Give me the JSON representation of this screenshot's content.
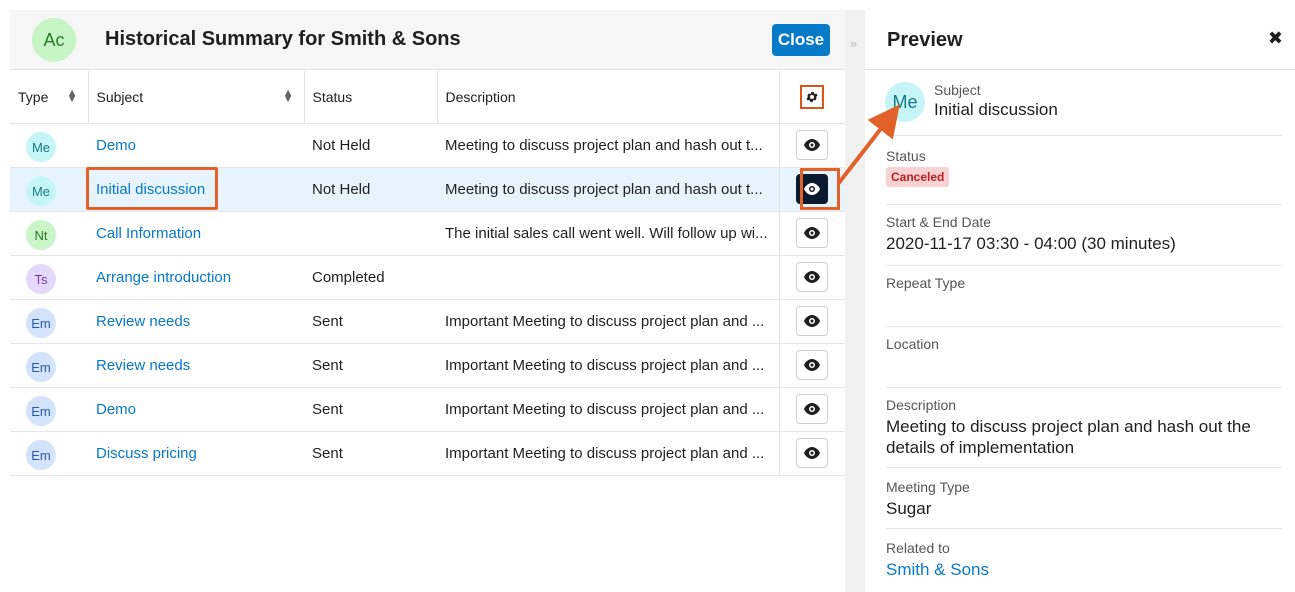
{
  "modal": {
    "avatar_initials": "Ac",
    "title": "Historical Summary for Smith & Sons",
    "close_label": "Close",
    "collapse_glyph": "»"
  },
  "table": {
    "columns": [
      "Type",
      "Subject",
      "Status",
      "Description"
    ],
    "rows": [
      {
        "type": "Me",
        "type_color": "#c6f5f7",
        "type_text_color": "#147a83",
        "subject": "Demo",
        "status": "Not Held",
        "description": "Meeting to discuss project plan and hash out t..."
      },
      {
        "type": "Me",
        "type_color": "#c6f5f7",
        "type_text_color": "#147a83",
        "subject": "Initial discussion",
        "status": "Not Held",
        "description": "Meeting to discuss project plan and hash out t..."
      },
      {
        "type": "Nt",
        "type_color": "#c9f5c9",
        "type_text_color": "#2a7a2a",
        "subject": "Call Information",
        "status": "",
        "description": "The initial sales call went well. Will follow up wi..."
      },
      {
        "type": "Ts",
        "type_color": "#e6d8fb",
        "type_text_color": "#6a3fb2",
        "subject": "Arrange introduction",
        "status": "Completed",
        "description": ""
      },
      {
        "type": "Em",
        "type_color": "#d3e3fb",
        "type_text_color": "#2b5aa8",
        "subject": "Review needs",
        "status": "Sent",
        "description": "Important Meeting to discuss project plan and ..."
      },
      {
        "type": "Em",
        "type_color": "#d3e3fb",
        "type_text_color": "#2b5aa8",
        "subject": "Review needs",
        "status": "Sent",
        "description": "Important Meeting to discuss project plan and ..."
      },
      {
        "type": "Em",
        "type_color": "#d3e3fb",
        "type_text_color": "#2b5aa8",
        "subject": "Demo",
        "status": "Sent",
        "description": "Important Meeting to discuss project plan and ..."
      },
      {
        "type": "Em",
        "type_color": "#d3e3fb",
        "type_text_color": "#2b5aa8",
        "subject": "Discuss pricing",
        "status": "Sent",
        "description": "Important Meeting to discuss project plan and ..."
      }
    ],
    "selected_row": 1
  },
  "preview": {
    "title": "Preview",
    "close_glyph": "✖",
    "avatar_initials": "Me",
    "subject_label": "Subject",
    "subject_value": "Initial discussion",
    "status_label": "Status",
    "status_value": "Canceled",
    "dates_label": "Start & End Date",
    "dates_value": "2020-11-17 03:30 - 04:00 (30 minutes)",
    "repeat_label": "Repeat Type",
    "repeat_value": "",
    "location_label": "Location",
    "location_value": "",
    "description_label": "Description",
    "description_value": "Meeting to discuss project plan and hash out the details of implementation",
    "meeting_type_label": "Meeting Type",
    "meeting_type_value": "Sugar",
    "related_label": "Related to",
    "related_value": "Smith & Sons"
  },
  "colors": {
    "accent": "#0679c8",
    "annotation": "#e2602a",
    "selected_row_bg": "#e8f4fd",
    "status_badge_bg": "#f7d3d3"
  }
}
